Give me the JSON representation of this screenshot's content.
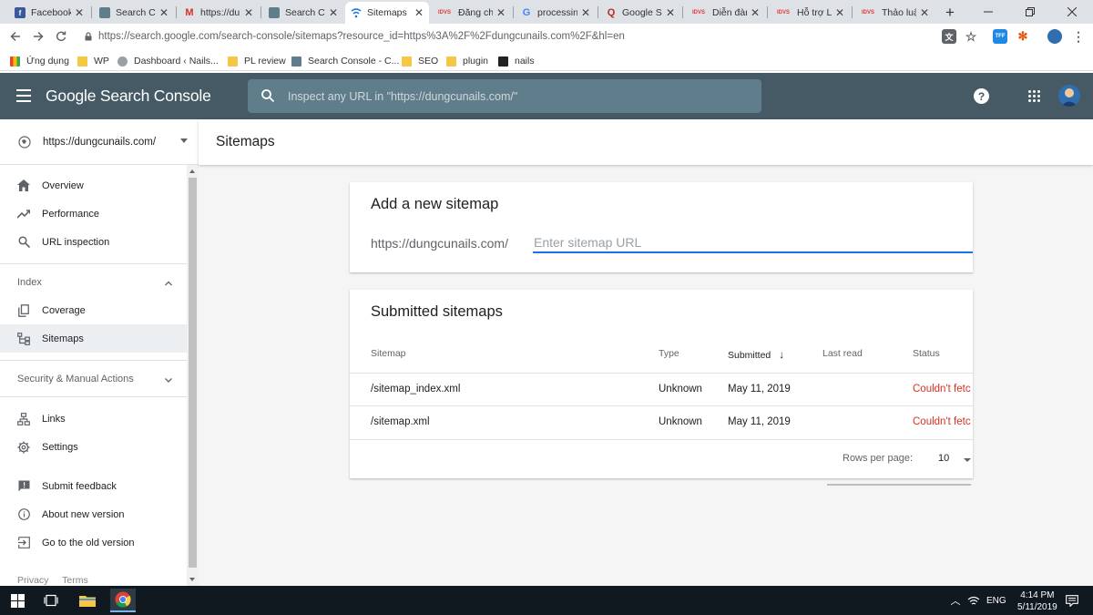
{
  "browser": {
    "tabs": [
      {
        "label": "Facebook",
        "icon": "facebook-icon",
        "color": "#3b5998",
        "glyph": "f"
      },
      {
        "label": "Search Co",
        "icon": "search-console-icon",
        "color": "#607d8b",
        "glyph": ""
      },
      {
        "label": "https://du",
        "icon": "gmail-icon",
        "color": "#d93025",
        "glyph": "M"
      },
      {
        "label": "Search Co",
        "icon": "search-console-icon",
        "color": "#607d8b",
        "glyph": ""
      },
      {
        "label": "Sitemaps",
        "icon": "sitemaps-tab-icon",
        "color": "#1a73e8",
        "glyph": ""
      },
      {
        "label": "Đăng chủ",
        "icon": "forum-icon",
        "color": "#e53935",
        "glyph": "IDVS"
      },
      {
        "label": "processin",
        "icon": "google-icon",
        "color": "#4285f4",
        "glyph": "G"
      },
      {
        "label": "Google Se",
        "icon": "quora-icon",
        "color": "#b92b27",
        "glyph": "Q"
      },
      {
        "label": "Diễn đàn",
        "icon": "forum-icon",
        "color": "#e53935",
        "glyph": "IDVS"
      },
      {
        "label": "Hỗ trợ Lậ",
        "icon": "forum-icon",
        "color": "#e53935",
        "glyph": "IDVS"
      },
      {
        "label": "Thảo luận",
        "icon": "forum-icon",
        "color": "#e53935",
        "glyph": "IDVS"
      }
    ],
    "new_tab": "+",
    "address": "https://search.google.com/search-console/sitemaps?resource_id=https%3A%2F%2Fdungcunails.com%2F&hl=en",
    "bookmarks": [
      {
        "label": "Ứng dụng",
        "icon": "apps-grid-icon"
      },
      {
        "label": "WP",
        "icon": "folder-icon"
      },
      {
        "label": "Dashboard ‹ Nails...",
        "icon": "wordpress-icon"
      },
      {
        "label": "PL review",
        "icon": "folder-icon"
      },
      {
        "label": "Search Console - C...",
        "icon": "search-console-icon"
      },
      {
        "label": "SEO",
        "icon": "folder-icon"
      },
      {
        "label": "plugin",
        "icon": "folder-icon"
      },
      {
        "label": "nails",
        "icon": "nails-icon"
      }
    ]
  },
  "header": {
    "title": "Google Search Console",
    "inspect_placeholder": "Inspect any URL in \"https://dungcunails.com/\"",
    "help_glyph": "?"
  },
  "sidebar": {
    "property": "https://dungcunails.com/",
    "items": [
      {
        "label": "Overview",
        "icon": "home-icon"
      },
      {
        "label": "Performance",
        "icon": "trending-up-icon"
      },
      {
        "label": "URL inspection",
        "icon": "search-icon"
      }
    ],
    "index_section": "Index",
    "index_items": [
      {
        "label": "Coverage",
        "icon": "coverage-icon"
      },
      {
        "label": "Sitemaps",
        "icon": "sitemap-icon"
      }
    ],
    "security_section": "Security & Manual Actions",
    "other_items": [
      {
        "label": "Links",
        "icon": "links-icon"
      },
      {
        "label": "Settings",
        "icon": "settings-icon"
      }
    ],
    "footer_items": [
      {
        "label": "Submit feedback",
        "icon": "feedback-icon"
      },
      {
        "label": "About new version",
        "icon": "info-icon"
      },
      {
        "label": "Go to the old version",
        "icon": "exit-icon"
      }
    ],
    "footer_links": [
      "Privacy",
      "Terms"
    ]
  },
  "main": {
    "page_title": "Sitemaps",
    "add_card": {
      "title": "Add a new sitemap",
      "prefix": "https://dungcunails.com/",
      "input_placeholder": "Enter sitemap URL"
    },
    "submitted_card": {
      "title": "Submitted sitemaps",
      "columns": [
        "Sitemap",
        "Type",
        "Submitted",
        "Last read",
        "Status"
      ],
      "sort_glyph": "↓",
      "rows": [
        {
          "sitemap": "/sitemap_index.xml",
          "type": "Unknown",
          "submitted": "May 11, 2019",
          "last_read": "",
          "status": "Couldn't fetc"
        },
        {
          "sitemap": "/sitemap.xml",
          "type": "Unknown",
          "submitted": "May 11, 2019",
          "last_read": "",
          "status": "Couldn't fetc"
        }
      ],
      "rows_per_page_label": "Rows per page:",
      "rows_per_page_value": "10"
    }
  },
  "taskbar": {
    "language": "ENG",
    "time": "4:14 PM",
    "date": "5/11/2019"
  },
  "colors": {
    "header_bg": "#455a64",
    "accent": "#1a73e8",
    "error": "#d93025"
  }
}
